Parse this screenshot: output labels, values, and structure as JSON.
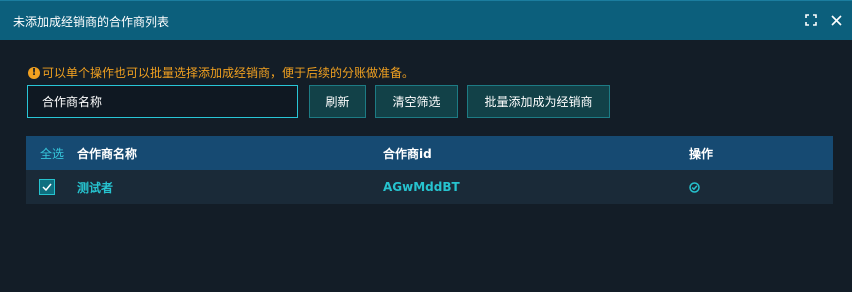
{
  "dialog": {
    "title": "未添加成经销商的合作商列表"
  },
  "tip": {
    "icon": "exclamation-circle-icon",
    "text": "可以单个操作也可以批量选择添加成经销商，便于后续的分账做准备。"
  },
  "search": {
    "placeholder": "合作商名称",
    "value": ""
  },
  "buttons": {
    "refresh": "刷新",
    "clear_filter": "清空筛选",
    "batch_add": "批量添加成为经销商"
  },
  "table": {
    "select_all": "全选",
    "columns": [
      "合作商名称",
      "合作商id",
      "操作"
    ],
    "rows": [
      {
        "checked": true,
        "name": "测试者",
        "id": "AGwMddBT",
        "action_icon": "check-circle-icon"
      }
    ]
  },
  "colors": {
    "titlebar": "#0c5f7c",
    "accent": "#26c3cf",
    "warning": "#f0a020",
    "table_header": "#164a72"
  }
}
